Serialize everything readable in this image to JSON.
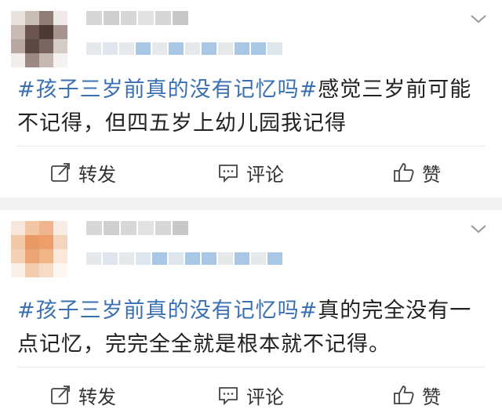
{
  "posts": [
    {
      "hashtag": "#孩子三岁前真的没有记忆吗#",
      "text": "感觉三岁前可能不记得，但四五岁上幼儿园我记得",
      "actions": {
        "repost": "转发",
        "comment": "评论",
        "like": "赞"
      }
    },
    {
      "hashtag": "#孩子三岁前真的没有记忆吗#",
      "text": "真的完全没有一点记忆，完完全全就是根本就不记得。",
      "actions": {
        "repost": "转发",
        "comment": "评论",
        "like": "赞"
      }
    }
  ],
  "colors": {
    "hashtag": "#3a6fb2",
    "text": "#222222",
    "background": "#f2f2f2",
    "card": "#ffffff"
  },
  "icons": {
    "repost": "repost-icon",
    "comment": "comment-icon",
    "like": "thumbs-up-icon",
    "menu": "chevron-down-icon"
  }
}
